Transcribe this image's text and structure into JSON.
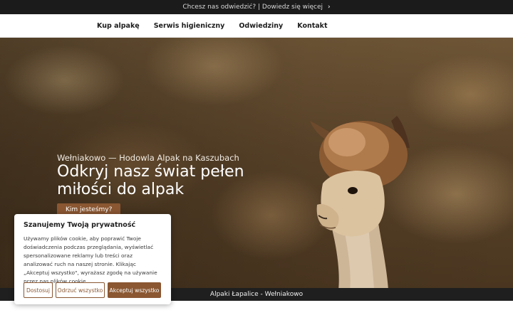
{
  "topbar": {
    "text": "Chcesz nas odwiedzić? | Dowiedz się więcej",
    "icon": "chevron-right-icon"
  },
  "nav": {
    "items": [
      "Kup alpakę",
      "Serwis higieniczny",
      "Odwiedziny",
      "Kontakt"
    ]
  },
  "hero": {
    "subtitle": "Wełniakowo — Hodowla Alpak na Kaszubach",
    "title": "Odkryj nasz świat pełen miłości do alpak",
    "button": "Kim jesteśmy?"
  },
  "footer": {
    "text": "Alpaki Łapalice - Wełniakowo"
  },
  "cookie": {
    "title": "Szanujemy Twoją prywatność",
    "body": "Używamy plików cookie, aby poprawić Twoje doświadczenia podczas przeglądania, wyświetlać spersonalizowane reklamy lub treści oraz analizować ruch na naszej stronie. Klikając „Akceptuj wszystko\", wyrażasz zgodę na używanie przez nas plików cookie.",
    "btn_customize": "Dostosuj",
    "btn_reject": "Odrzuć wszystko",
    "btn_accept": "Akceptuj wszystko"
  },
  "colors": {
    "accent": "#8a5732",
    "topbar": "#1b1b1b"
  }
}
